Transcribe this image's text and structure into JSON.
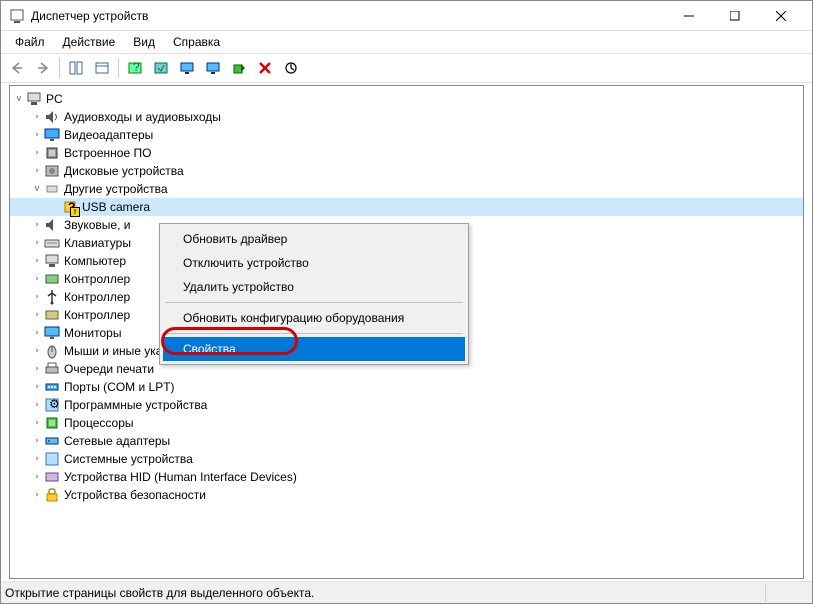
{
  "window": {
    "title": "Диспетчер устройств"
  },
  "menus": [
    "Файл",
    "Действие",
    "Вид",
    "Справка"
  ],
  "tree": {
    "root": "PC",
    "items": [
      {
        "label": "Аудиовходы и аудиовыходы",
        "exp": "›",
        "icon": "audio"
      },
      {
        "label": "Видеоадаптеры",
        "exp": "›",
        "icon": "display"
      },
      {
        "label": "Встроенное ПО",
        "exp": "›",
        "icon": "chip"
      },
      {
        "label": "Дисковые устройства",
        "exp": "›",
        "icon": "disk"
      },
      {
        "label": "Другие устройства",
        "exp": "v",
        "icon": "other",
        "children": [
          {
            "label": "USB camera",
            "icon": "unknown",
            "warn": true
          }
        ]
      },
      {
        "label": "Звуковые, и",
        "exp": "›",
        "icon": "sound"
      },
      {
        "label": "Клавиатуры",
        "exp": "›",
        "icon": "keyboard"
      },
      {
        "label": "Компьютер",
        "exp": "›",
        "icon": "pc"
      },
      {
        "label": "Контроллер",
        "exp": "›",
        "icon": "storage"
      },
      {
        "label": "Контроллер",
        "exp": "›",
        "icon": "usb"
      },
      {
        "label": "Контроллер",
        "exp": "›",
        "icon": "storage2"
      },
      {
        "label": "Мониторы",
        "exp": "›",
        "icon": "monitor"
      },
      {
        "label": "Мыши и иные указывающие устройства",
        "exp": "›",
        "icon": "mouse"
      },
      {
        "label": "Очереди печати",
        "exp": "›",
        "icon": "printer"
      },
      {
        "label": "Порты (COM и LPT)",
        "exp": "›",
        "icon": "port"
      },
      {
        "label": "Программные устройства",
        "exp": "›",
        "icon": "soft"
      },
      {
        "label": "Процессоры",
        "exp": "›",
        "icon": "cpu"
      },
      {
        "label": "Сетевые адаптеры",
        "exp": "›",
        "icon": "net"
      },
      {
        "label": "Системные устройства",
        "exp": "›",
        "icon": "sys"
      },
      {
        "label": "Устройства HID (Human Interface Devices)",
        "exp": "›",
        "icon": "hid"
      },
      {
        "label": "Устройства безопасности",
        "exp": "›",
        "icon": "sec"
      }
    ]
  },
  "context_menu": {
    "items": [
      {
        "label": "Обновить драйвер"
      },
      {
        "label": "Отключить устройство"
      },
      {
        "label": "Удалить устройство"
      },
      {
        "sep": true
      },
      {
        "label": "Обновить конфигурацию оборудования"
      },
      {
        "sep": true
      },
      {
        "label": "Свойства",
        "hl": true
      }
    ]
  },
  "status": "Открытие страницы свойств для выделенного объекта."
}
